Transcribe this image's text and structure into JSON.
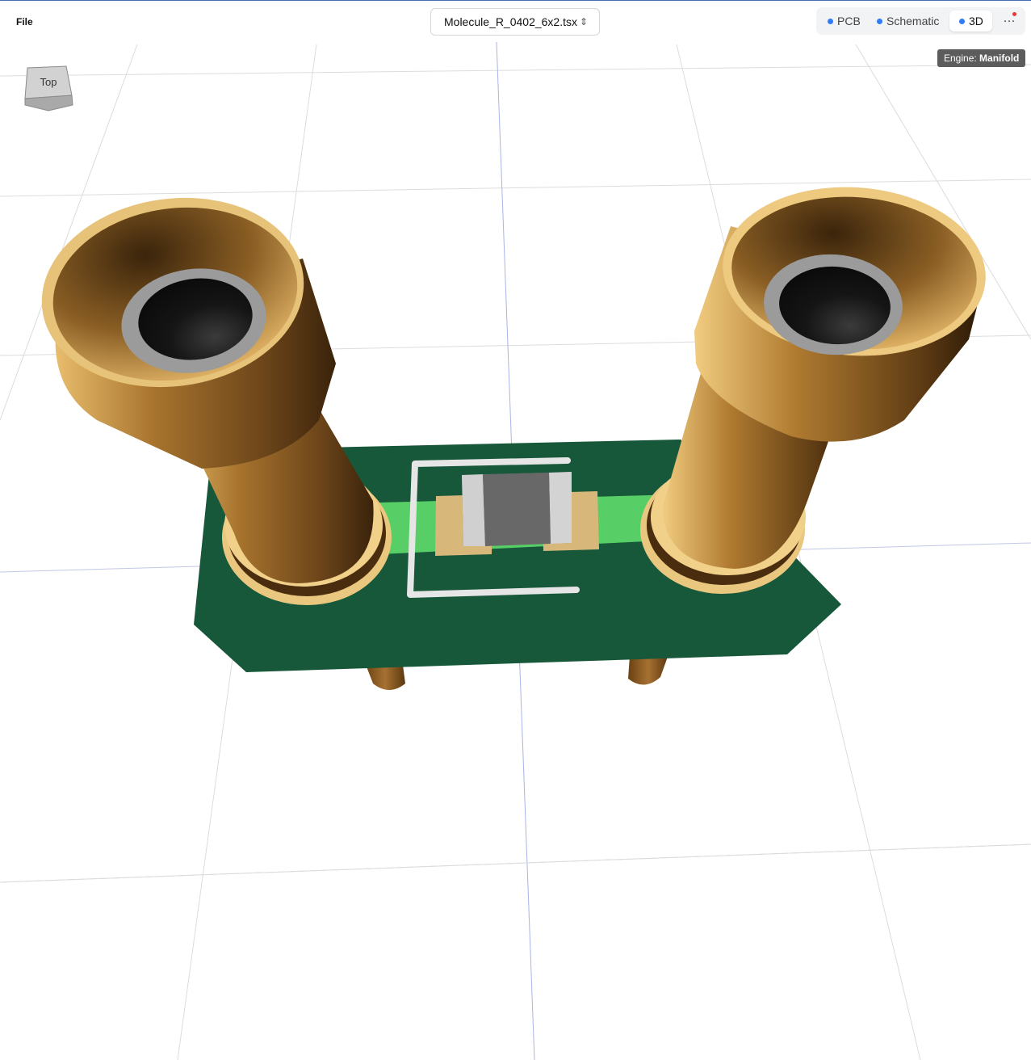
{
  "toolbar": {
    "file_menu": "File",
    "file_name": "Molecule_R_0402_6x2.tsx",
    "tabs": [
      {
        "label": "PCB",
        "active": false
      },
      {
        "label": "Schematic",
        "active": false
      },
      {
        "label": "3D",
        "active": true
      }
    ],
    "more_label": "···"
  },
  "engine": {
    "prefix": "Engine:",
    "name": "Manifold"
  },
  "view_cube": {
    "face_label": "Top"
  },
  "colors": {
    "board": "#17573a",
    "trace": "#57cf66",
    "silkscreen": "#eaeaea",
    "pad": "#d8b87a",
    "connector_gold": "#c08d3e",
    "resistor_body": "#6a6a6a",
    "tab_dot": "#2f7cf6"
  },
  "icons": {
    "file_select": "chevron-updown-icon",
    "more": "ellipsis-icon",
    "notification": "red-dot-icon"
  }
}
